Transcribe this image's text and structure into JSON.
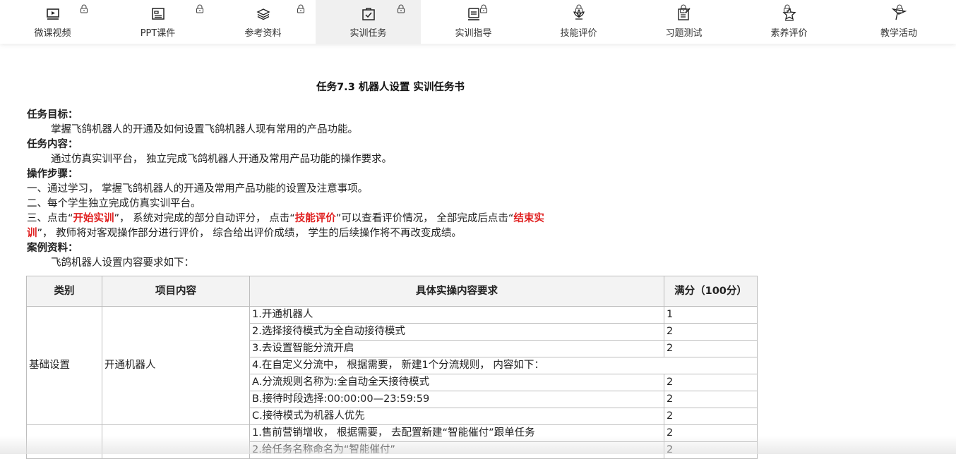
{
  "tabs": [
    {
      "label": "微课视频",
      "icon": "video-icon",
      "active": false
    },
    {
      "label": "PPT课件",
      "icon": "slides-icon",
      "active": false
    },
    {
      "label": "参考资料",
      "icon": "layers-icon",
      "active": false
    },
    {
      "label": "实训任务",
      "icon": "task-icon",
      "active": true
    },
    {
      "label": "实训指导",
      "icon": "monitor-icon",
      "active": false
    },
    {
      "label": "技能评价",
      "icon": "lotus-icon",
      "active": false
    },
    {
      "label": "习题测试",
      "icon": "edit-icon",
      "active": false
    },
    {
      "label": "素养评价",
      "icon": "star-icon",
      "active": false
    },
    {
      "label": "教学活动",
      "icon": "flag-icon",
      "active": false
    }
  ],
  "doc": {
    "title": "任务7.3 机器人设置 实训任务书",
    "goal_heading": "任务目标：",
    "goal_text": "掌握飞鸽机器人的开通及如何设置飞鸽机器人现有常用的产品功能。",
    "content_heading": "任务内容：",
    "content_text": "通过仿真实训平台， 独立完成飞鸽机器人开通及常用产品功能的操作要求。",
    "steps_heading": "操作步骤：",
    "step1": "一、通过学习， 掌握飞鸽机器人的开通及常用产品功能的设置及注意事项。",
    "step2": "二、每个学生独立完成仿真实训平台。",
    "step3": {
      "p1": "三、点击“",
      "r1": "开始实训",
      "p2": "”， 系统对完成的部分自动评分， 点击“",
      "r2": "技能评价",
      "p3": "”可以查看评价情况， 全部完成后点击“",
      "r3a": "结束实",
      "r3b": "训",
      "p4": "”， 教师将对客观操作部分进行评价， 综合给出评价成绩， 学生的后续操作将不再改变成绩。"
    },
    "case_heading": "案例资料：",
    "case_text": "飞鸽机器人设置内容要求如下："
  },
  "table": {
    "headers": [
      "类别",
      "项目内容",
      "具体实操内容要求",
      "满分（100分）"
    ],
    "group1": {
      "category": "基础设置",
      "item": "开通机器人"
    },
    "rows1": [
      {
        "req": "1.开通机器人",
        "score": "1"
      },
      {
        "req": "2.选择接待模式为全自动接待模式",
        "score": "2"
      },
      {
        "req": "3.去设置智能分流开启",
        "score": "2"
      },
      {
        "req": "4.在自定义分流中， 根据需要， 新建1个分流规则， 内容如下：",
        "score": ""
      },
      {
        "req": "A.分流规则名称为:全自动全天接待模式",
        "score": "2"
      },
      {
        "req": "B.接待时段选择:00:00:00—23:59:59",
        "score": "2"
      },
      {
        "req": "C.接待模式为机器人优先",
        "score": "2"
      }
    ],
    "rows2": [
      {
        "req": "1.售前营销增收， 根据需要， 去配置新建“智能催付”跟单任务",
        "score": "2"
      },
      {
        "req": "2.给任务名称命名为“智能催付”",
        "score": "2"
      }
    ]
  }
}
